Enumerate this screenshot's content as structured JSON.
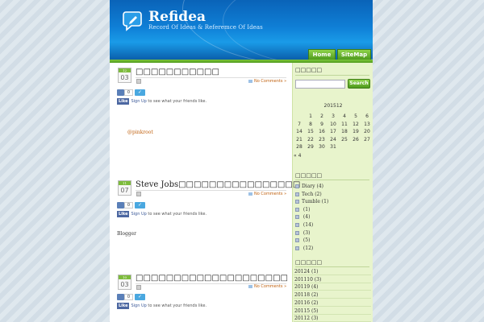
{
  "header": {
    "title": "Refidea",
    "description": "Record Of Ideas & Referemce Of Ideas",
    "nav": [
      "Home",
      "SiteMap"
    ],
    "logo_icon": "speech-bubble-pencil-icon"
  },
  "posts": [
    {
      "month": "12",
      "day": "03",
      "title": "□□□□□□□□□□□",
      "comments": "No Comments »",
      "like_count": "0",
      "like_label": "Like",
      "signup_link": "Sign Up",
      "signup_text": " to see what your friends like.",
      "body": "@pinkroot"
    },
    {
      "month": "11",
      "day": "07",
      "title": "Steve Jobs□□□□□□□□□□□□□□□□",
      "comments": "No Comments »",
      "like_count": "0",
      "like_label": "Like",
      "signup_link": "Sign Up",
      "signup_text": " to see what your friends like.",
      "body": "Blogger"
    },
    {
      "month": "10",
      "day": "03",
      "title": "□□□□□□□□□□□□□□□□□□□□",
      "comments": "No Comments »",
      "like_count": "0",
      "like_label": "Like",
      "signup_link": "Sign Up",
      "signup_text": " to see what your friends like."
    }
  ],
  "sidebar": {
    "search_title": "□□□□□",
    "search_placeholder": "",
    "search_button": "Search",
    "calendar": {
      "caption": "201512",
      "weeks": [
        [
          "",
          "1",
          "2",
          "3",
          "4",
          "5",
          "6"
        ],
        [
          "7",
          "8",
          "9",
          "10",
          "11",
          "12",
          "13"
        ],
        [
          "14",
          "15",
          "16",
          "17",
          "18",
          "19",
          "20"
        ],
        [
          "21",
          "22",
          "23",
          "24",
          "25",
          "26",
          "27"
        ],
        [
          "28",
          "29",
          "30",
          "31",
          "",
          "",
          ""
        ]
      ],
      "prev": "« 4"
    },
    "categories_title": "□□□□□",
    "categories": [
      "Diary (4)",
      "Tech (2)",
      "Tumble (1)",
      " (1)",
      " (4)",
      " (14)",
      " (3)",
      "   (5)",
      " (12)"
    ],
    "archives_title": "□□□□□",
    "archives": [
      "20124 (1)",
      "201110 (3)",
      "20119 (4)",
      "20118 (2)",
      "20116 (2)",
      "20115 (5)",
      "20112 (3)"
    ]
  },
  "colors": {
    "header_blue": "#0f7fd6",
    "accent_green": "#5aa827",
    "sidebar_bg": "#e8f4cc",
    "link_orange": "#c0610f"
  }
}
